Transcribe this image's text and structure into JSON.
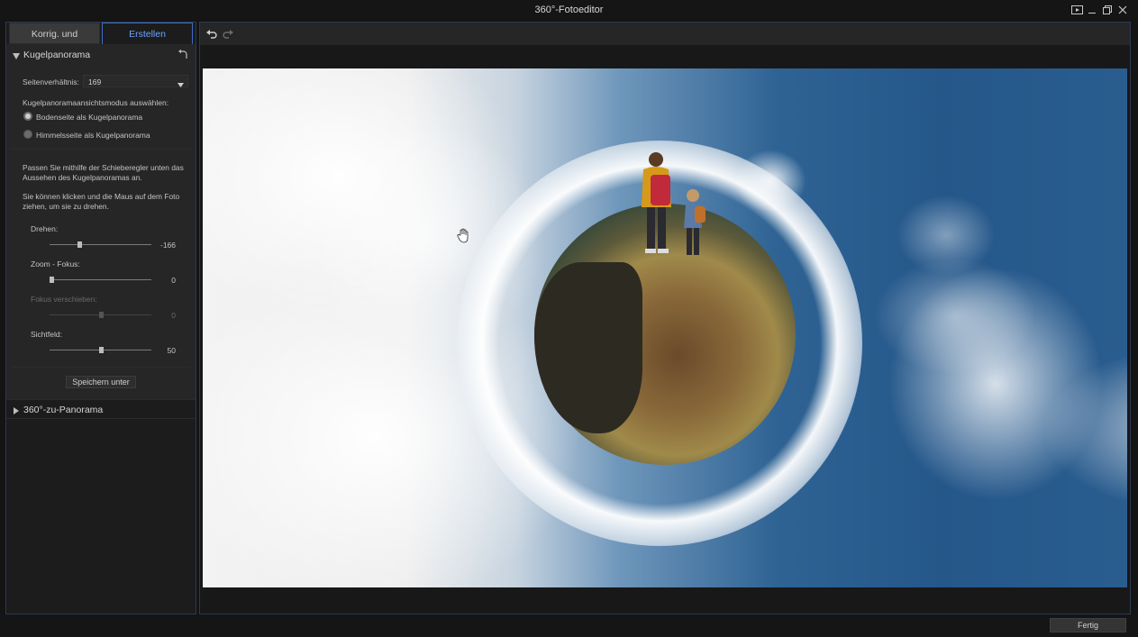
{
  "window": {
    "title": "360°-Fotoeditor"
  },
  "tabs": [
    {
      "label": "Korrig. und ausrichten"
    },
    {
      "label": "Erstellen"
    }
  ],
  "sphere_section": {
    "title": "Kugelpanorama",
    "aspect_label": "Seitenverhältnis:",
    "aspect_value": "169",
    "mode_label": "Kugelpanoramaansichtsmodus auswählen:",
    "modes": [
      {
        "label": "Bodenseite als Kugelpanorama",
        "selected": true
      },
      {
        "label": "Himmelsseite als Kugelpanorama",
        "selected": false
      }
    ],
    "help1": "Passen Sie mithilfe der Schieberegler unten das Aussehen des Kugelpanoramas an.",
    "help2": "Sie können klicken und die Maus auf dem Foto ziehen, um sie zu drehen.",
    "sliders": [
      {
        "label": "Drehen:",
        "value": "-166",
        "fraction": 0.28,
        "enabled": true
      },
      {
        "label": "Zoom - Fokus:",
        "value": "0",
        "fraction": 0.0,
        "enabled": true
      },
      {
        "label": "Fokus verschieben:",
        "value": "0",
        "fraction": 0.5,
        "enabled": false
      },
      {
        "label": "Sichtfeld:",
        "value": "50",
        "fraction": 0.5,
        "enabled": true
      }
    ],
    "save_button": "Speichern unter"
  },
  "panorama_section": {
    "title": "360°-zu-Panorama"
  },
  "footer": {
    "done_button": "Fertig"
  },
  "colors": {
    "accent": "#6ea3ff",
    "panel_border": "#2a3a52"
  }
}
